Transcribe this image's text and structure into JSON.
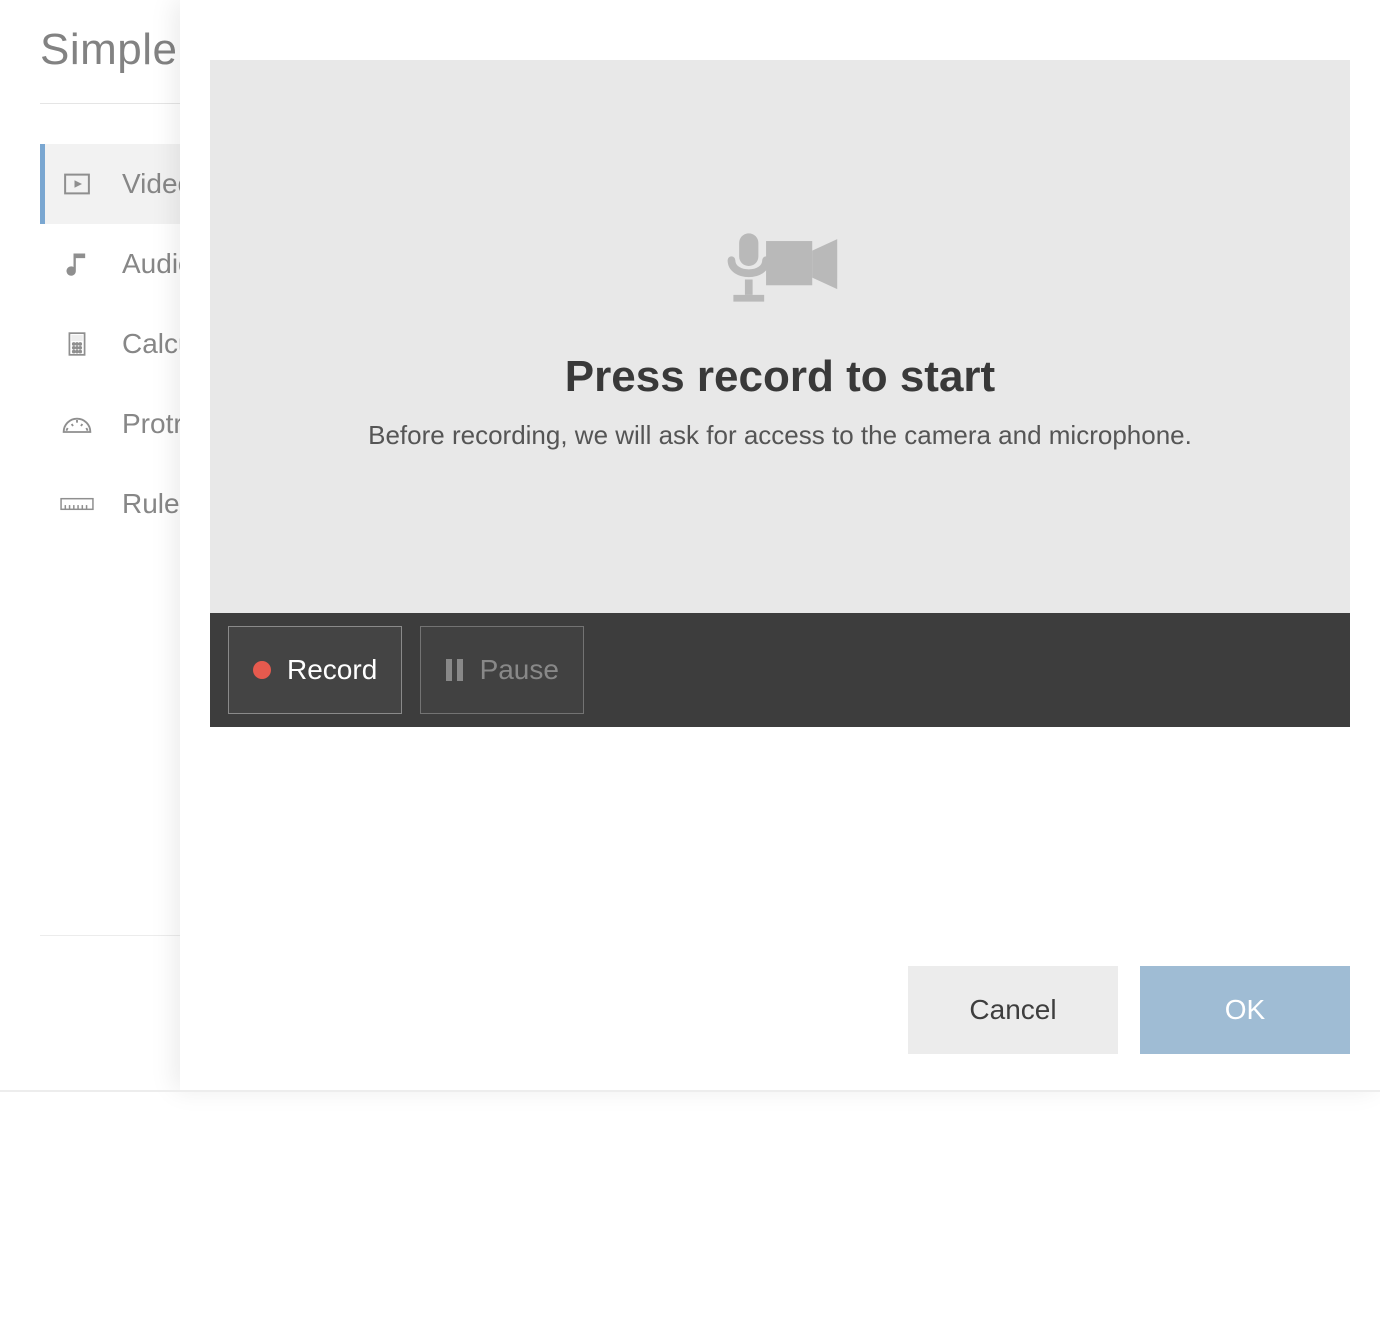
{
  "page": {
    "title": "Simple F"
  },
  "sidebar": {
    "items": [
      {
        "label": "Video",
        "icon": "play-box-icon",
        "active": true
      },
      {
        "label": "Audio",
        "icon": "music-note-icon",
        "active": false
      },
      {
        "label": "Calculator",
        "icon": "calculator-icon",
        "active": false
      },
      {
        "label": "Protractor",
        "icon": "protractor-icon",
        "active": false
      },
      {
        "label": "Ruler",
        "icon": "ruler-icon",
        "active": false
      }
    ]
  },
  "modal": {
    "heading": "Press record to start",
    "subtext": "Before recording, we will ask for access to the camera and microphone.",
    "controls": {
      "record_label": "Record",
      "pause_label": "Pause"
    },
    "footer": {
      "cancel_label": "Cancel",
      "ok_label": "OK"
    }
  }
}
